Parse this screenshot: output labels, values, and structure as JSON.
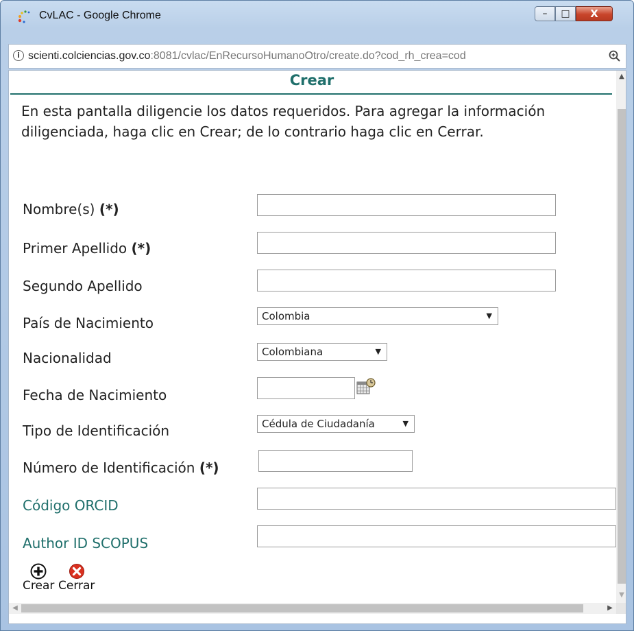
{
  "window": {
    "title": "CvLAC - Google Chrome",
    "controls": {
      "minimize": "–",
      "maximize": "□",
      "close": "X"
    }
  },
  "address_bar": {
    "host": "scienti.colciencias.gov.co",
    "path": ":8081/cvlac/EnRecursoHumanoOtro/create.do?cod_rh_crea=cod"
  },
  "page": {
    "title": "Crear",
    "intro": "En esta pantalla diligencie los datos requeridos. Para agregar la información diligenciada, haga clic en Crear; de lo contrario haga clic en Cerrar."
  },
  "form": {
    "nombres": {
      "label": "Nombre(s)",
      "required_mark": "(*)",
      "value": ""
    },
    "primer_apellido": {
      "label": "Primer Apellido",
      "required_mark": "(*)",
      "value": ""
    },
    "segundo_apellido": {
      "label": "Segundo Apellido",
      "value": ""
    },
    "pais_nacimiento": {
      "label": "País de Nacimiento",
      "selected": "Colombia"
    },
    "nacionalidad": {
      "label": "Nacionalidad",
      "selected": "Colombiana"
    },
    "fecha_nacimiento": {
      "label": "Fecha de Nacimiento",
      "value": ""
    },
    "tipo_identificacion": {
      "label": "Tipo de Identificación",
      "selected": "Cédula de Ciudadanía"
    },
    "numero_identificacion": {
      "label": "Número de Identificación",
      "required_mark": "(*)",
      "value": ""
    },
    "orcid": {
      "label": "Código ORCID",
      "value": ""
    },
    "scopus": {
      "label": "Author ID SCOPUS",
      "value": ""
    }
  },
  "actions": {
    "crear": {
      "label": "Crear",
      "icon": "plus-circle-icon"
    },
    "cerrar": {
      "label": "Cerrar",
      "icon": "close-circle-icon"
    }
  },
  "colors": {
    "accent_teal": "#1f6f6b",
    "close_red": "#d9301f",
    "window_blue": "#b9cfe8"
  }
}
